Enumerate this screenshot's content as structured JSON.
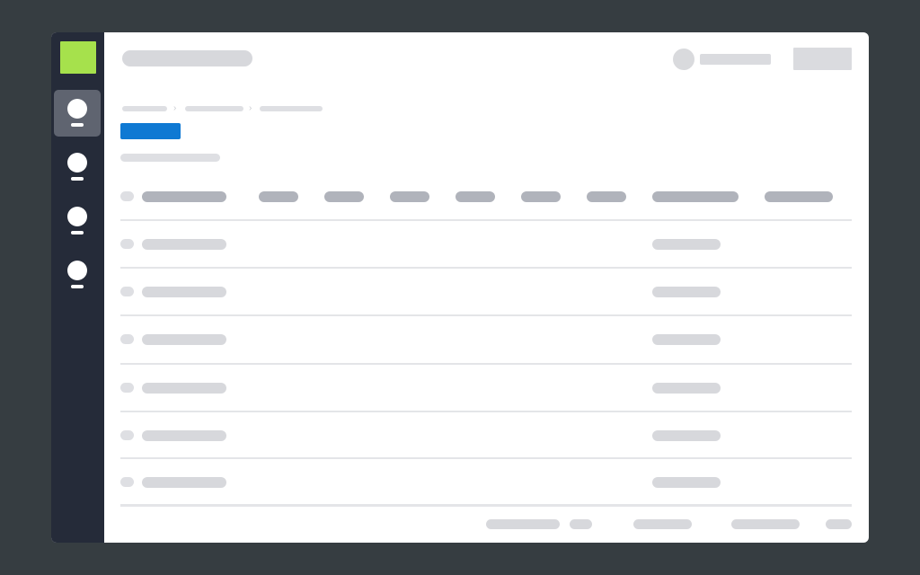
{
  "app": {
    "title": "",
    "colors": {
      "backdrop": "#363d41",
      "sidebar": "#252b39",
      "logo": "#a6e14c",
      "primary_button": "#0f79d3",
      "placeholder": "#d7d8dc",
      "placeholder_dark": "#b0b3bb"
    }
  },
  "sidebar": {
    "items": [
      {
        "icon": "user-icon",
        "active": true
      },
      {
        "icon": "user-icon",
        "active": false
      },
      {
        "icon": "user-icon",
        "active": false
      },
      {
        "icon": "user-icon",
        "active": false
      }
    ]
  },
  "header": {
    "search_placeholder": "",
    "user_name": "",
    "action_label": ""
  },
  "breadcrumb": {
    "items": [
      "",
      "",
      ""
    ],
    "separator": "›"
  },
  "main": {
    "primary_button_label": "",
    "subtitle": ""
  },
  "table": {
    "columns": [
      "",
      "",
      "",
      "",
      "",
      "",
      "",
      ""
    ],
    "rows": [
      {
        "name": "",
        "value": ""
      },
      {
        "name": "",
        "value": ""
      },
      {
        "name": "",
        "value": ""
      },
      {
        "name": "",
        "value": ""
      },
      {
        "name": "",
        "value": ""
      },
      {
        "name": "",
        "value": ""
      }
    ]
  },
  "pagination": {
    "items": [
      "",
      "",
      "",
      "",
      ""
    ]
  }
}
